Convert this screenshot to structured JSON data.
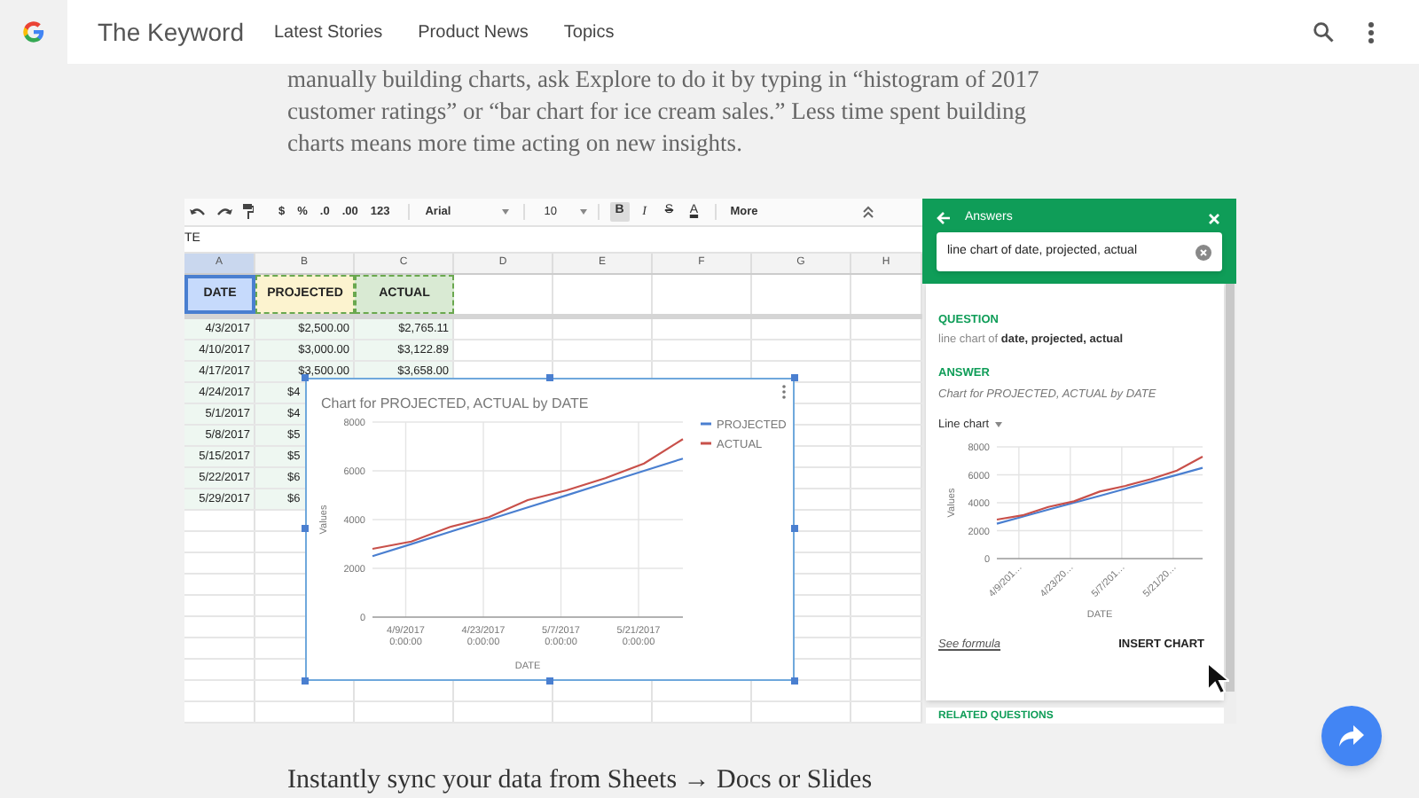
{
  "header": {
    "brand": "The Keyword",
    "nav": [
      {
        "label": "Latest Stories"
      },
      {
        "label": "Product News"
      },
      {
        "label": "Topics"
      }
    ]
  },
  "intro": {
    "lines": [
      "manually building charts, ask Explore to do it by typing in “histogram of 2017",
      "customer ratings” or “bar chart for ice cream sales.” Less time spent building",
      "charts means more time acting on new insights."
    ]
  },
  "screenshot": {
    "toolbar": {
      "format_items": [
        "$",
        "%",
        ".0",
        ".00",
        "123"
      ],
      "font": "Arial",
      "size": "10",
      "style_buttons": [
        {
          "label": "B",
          "selected": true
        },
        {
          "label": "I",
          "selected": false
        },
        {
          "label": "S",
          "selected": false
        },
        {
          "label": "A",
          "selected": false
        }
      ],
      "more": "More"
    },
    "formula_bar": "TE",
    "sheet": {
      "columns": [
        {
          "label": "A",
          "selected": true
        },
        {
          "label": "B",
          "selected": false
        },
        {
          "label": "C",
          "selected": false
        },
        {
          "label": "D",
          "selected": false
        },
        {
          "label": "E",
          "selected": false
        },
        {
          "label": "F",
          "selected": false
        },
        {
          "label": "G",
          "selected": false
        },
        {
          "label": "H",
          "selected": false
        }
      ],
      "header_row": [
        {
          "text": "DATE",
          "color": "#c6dafc"
        },
        {
          "text": "PROJECTED",
          "color": "#fcf3cf"
        },
        {
          "text": "ACTUAL",
          "color": "#d9ead3"
        }
      ],
      "rows": [
        [
          "4/3/2017",
          "$2,500.00",
          "$2,765.11"
        ],
        [
          "4/10/2017",
          "$3,000.00",
          "$3,122.89"
        ],
        [
          "4/17/2017",
          "$3,500.00",
          "$3,658.00"
        ],
        [
          "4/24/2017",
          "$4"
        ],
        [
          "5/1/2017",
          "$4"
        ],
        [
          "5/8/2017",
          "$5"
        ],
        [
          "5/15/2017",
          "$5"
        ],
        [
          "5/22/2017",
          "$6"
        ],
        [
          "5/29/2017",
          "$6"
        ]
      ]
    },
    "chart": {
      "chart_data": {
        "type": "line",
        "title": "Chart for PROJECTED, ACTUAL by DATE",
        "xlabel": "DATE",
        "ylabel": "Values",
        "categories": [
          null,
          "4/9/2017\n0:00:00",
          null,
          "4/23/2017\n0:00:00",
          null,
          "5/7/2017\n0:00:00",
          null,
          "5/21/2017\n0:00:00",
          null
        ],
        "series": [
          {
            "name": "PROJECTED",
            "color": "#4a7fd0",
            "values": [
              2500,
              3000,
              3500,
              4000,
              4500,
              5000,
              5500,
              6000,
              6500
            ]
          },
          {
            "name": "ACTUAL",
            "color": "#c8504a",
            "values": [
              2800,
              3100,
              3700,
              4100,
              4800,
              5200,
              5700,
              6300,
              7300
            ]
          }
        ],
        "ylim": [
          0,
          8000
        ],
        "yticks": [
          0,
          2000,
          4000,
          6000,
          8000
        ],
        "grid": true,
        "legend": "right"
      }
    },
    "explore": {
      "title": "Answers",
      "query": "line chart of date, projected, actual",
      "question_label": "QUESTION",
      "question": "line chart of **date, projected, actual**",
      "answer_label": "ANSWER",
      "answer": "Chart for PROJECTED, ACTUAL by DATE",
      "chart_type": "Line chart",
      "chart": {
        "chart_data": {
          "type": "line",
          "xlabel": "DATE",
          "ylabel": "Values",
          "categories": [
            null,
            "4/9/201…",
            null,
            "4/23/20…",
            null,
            "5/7/201…",
            null,
            "5/21/20…",
            null
          ],
          "series": [
            {
              "color": "#4a7fd0",
              "values": [
                2500,
                3000,
                3500,
                4000,
                4500,
                5000,
                5500,
                6000,
                6500
              ]
            },
            {
              "color": "#c8504a",
              "values": [
                2800,
                3100,
                3700,
                4100,
                4800,
                5200,
                5700,
                6300,
                7300
              ]
            }
          ],
          "ylim": [
            0,
            8000
          ],
          "yticks": [
            0,
            2000,
            4000,
            6000,
            8000
          ],
          "grid": true
        }
      },
      "formula_link": "See formula",
      "insert_button": "INSERT CHART",
      "related_label": "RELATED QUESTIONS"
    }
  },
  "caption": "Instantly sync your data from Sheets → Docs or Slides"
}
